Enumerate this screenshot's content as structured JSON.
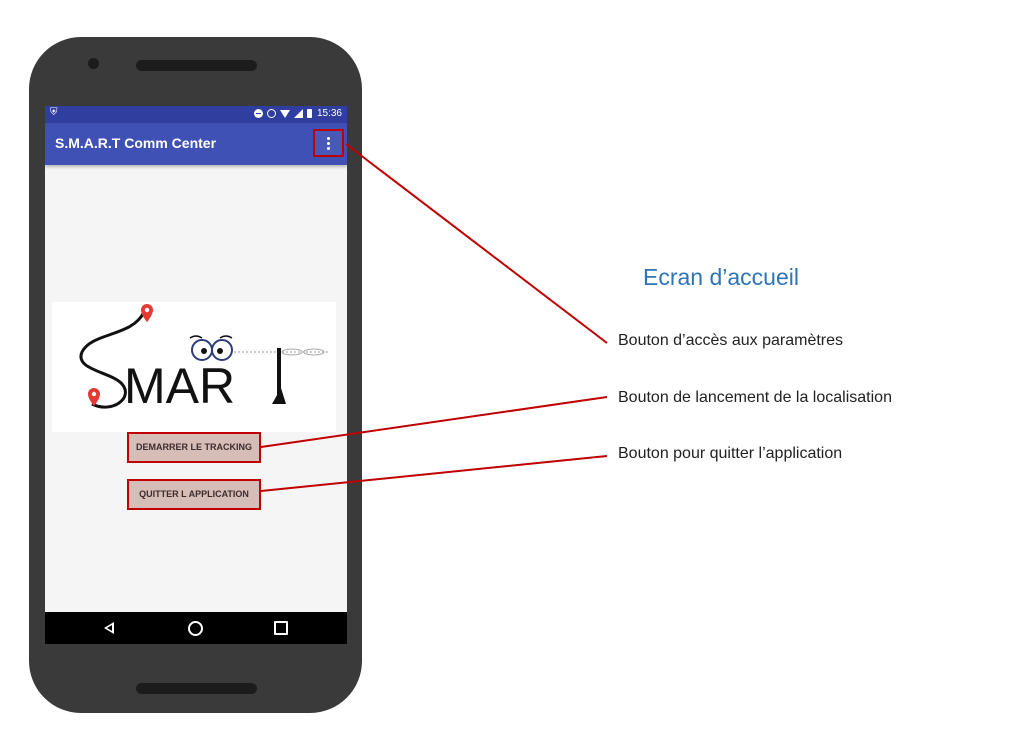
{
  "status_bar": {
    "time": "15:36"
  },
  "app_bar": {
    "title": "S.M.A.R.T Comm Center",
    "menu_icon": "more-vert-icon"
  },
  "logo": {
    "text": "SMART",
    "pin_color": "#e53935"
  },
  "buttons": {
    "start_tracking": "DEMARRER LE TRACKING",
    "quit_app": "QUITTER L APPLICATION"
  },
  "nav_bar": {
    "icons": [
      "back-icon",
      "home-icon",
      "recent-apps-icon"
    ]
  },
  "annotations": {
    "heading": "Ecran d’accueil",
    "settings_label": "Bouton d’accès aux paramètres",
    "start_label": "Bouton de lancement de la localisation",
    "quit_label": "Bouton pour quitter l’application"
  },
  "colors": {
    "accent_red": "#c00000",
    "app_bar": "#3f51b5",
    "status_bar": "#303f9f",
    "heading": "#2e75b6"
  }
}
